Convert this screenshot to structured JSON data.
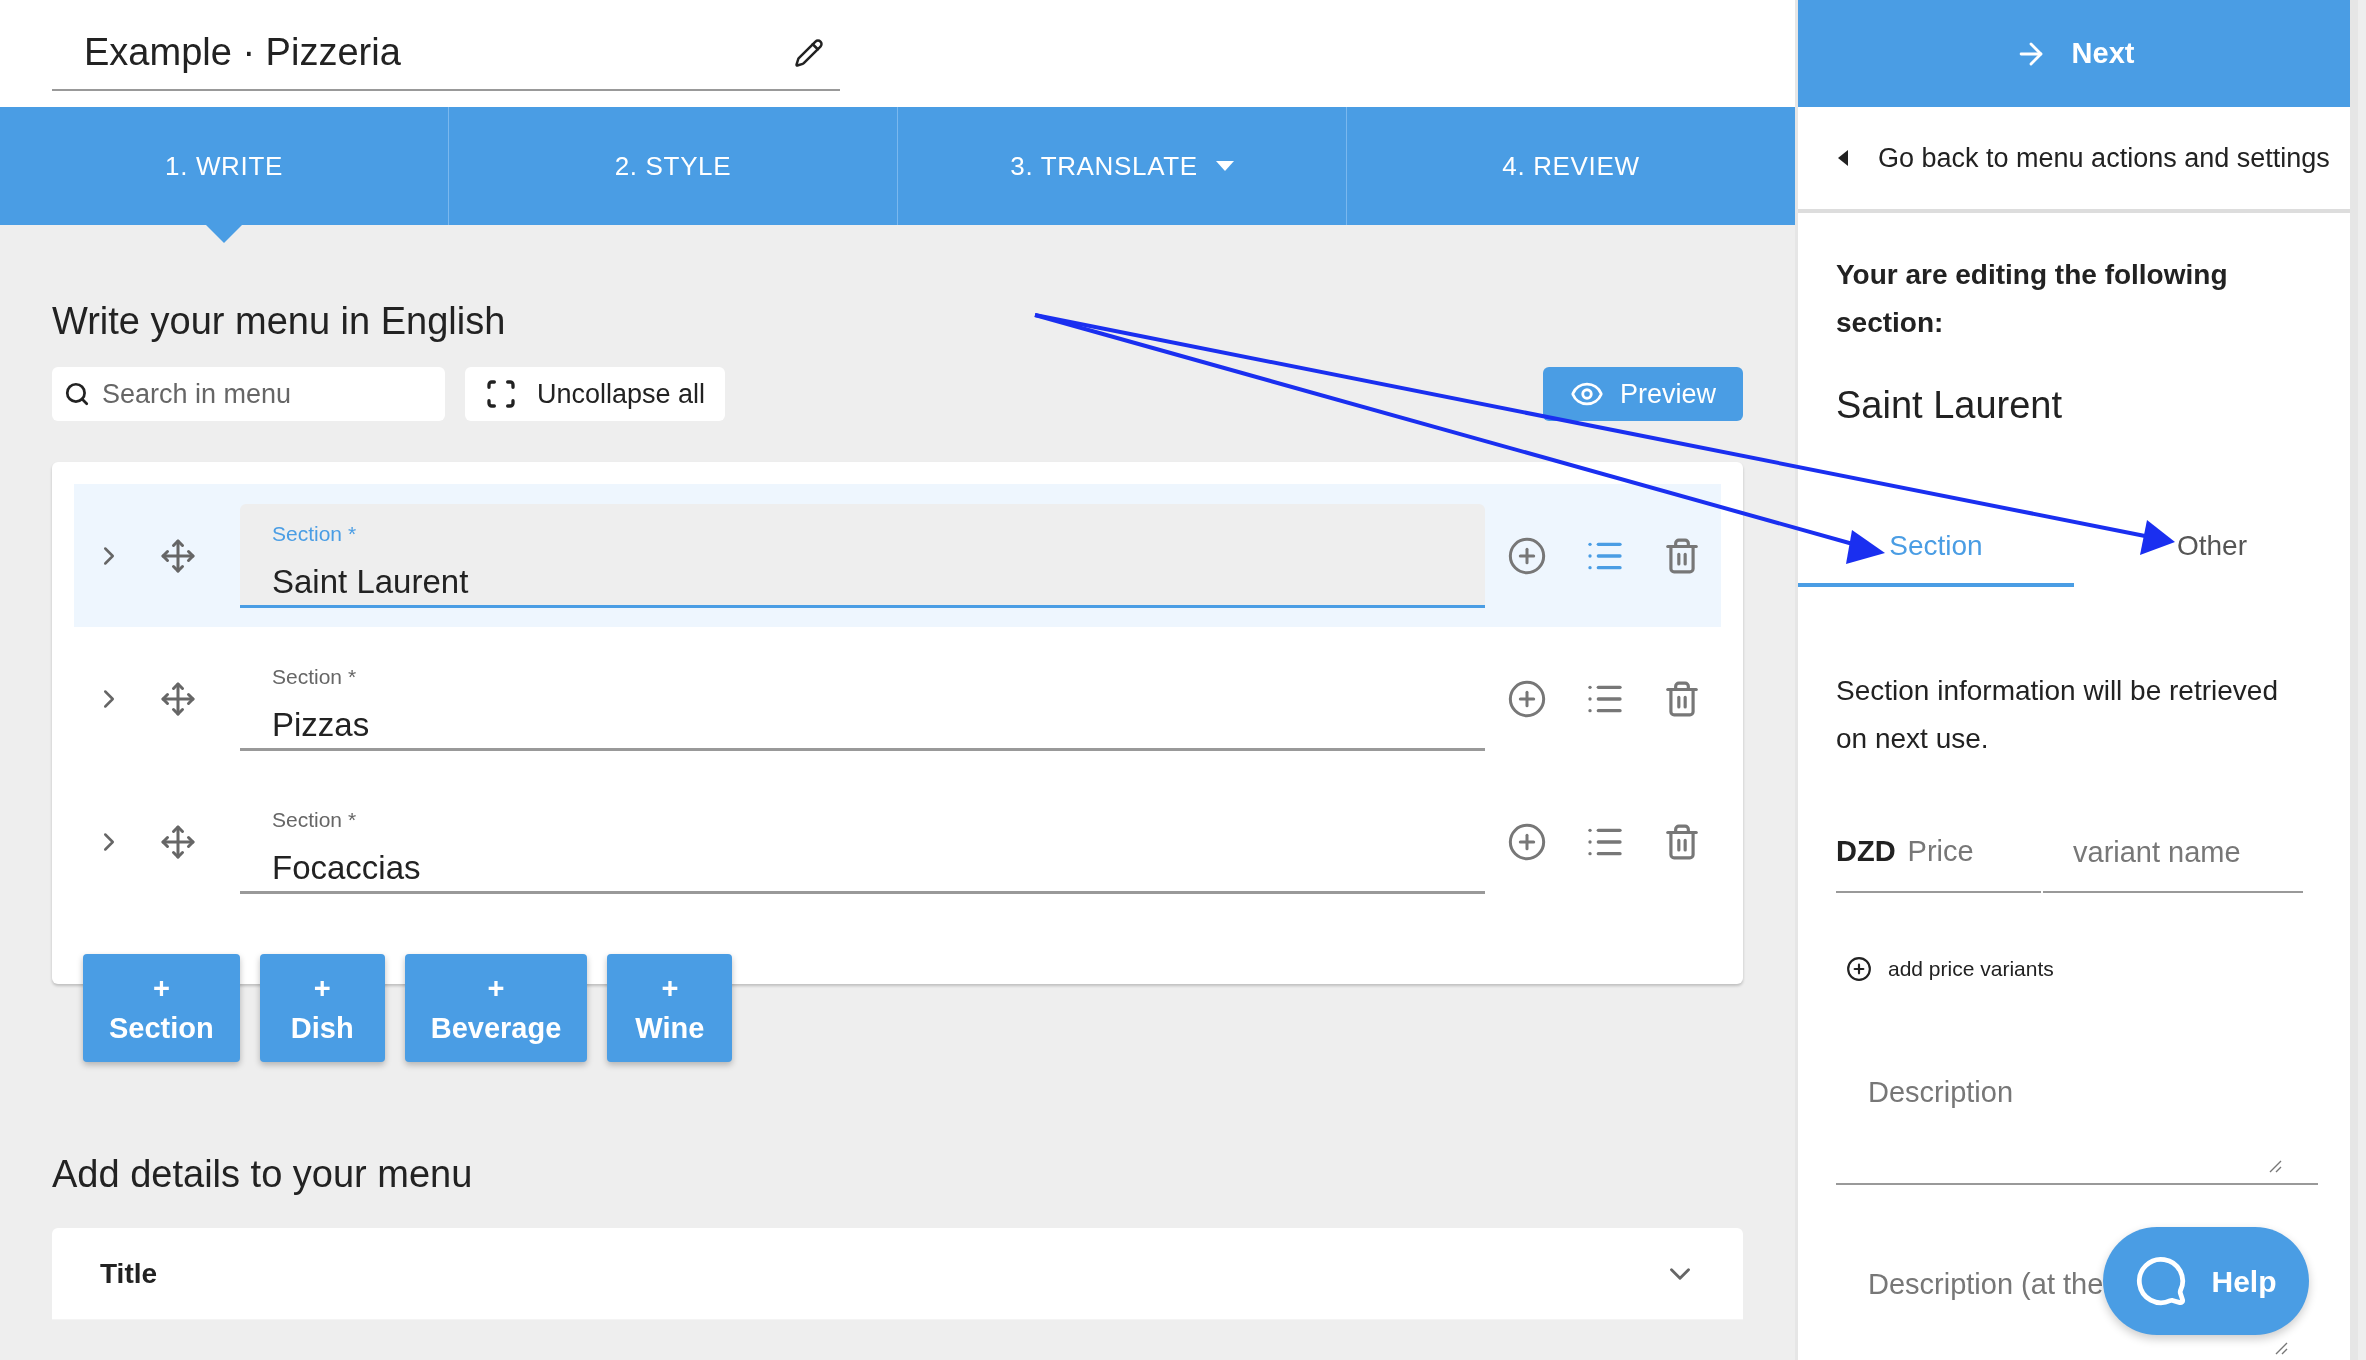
{
  "header": {
    "title": "Example · Pizzeria"
  },
  "steps": [
    {
      "label": "1. WRITE",
      "selected": true,
      "dropdown": false
    },
    {
      "label": "2. STYLE",
      "selected": false,
      "dropdown": false
    },
    {
      "label": "3. TRANSLATE",
      "selected": false,
      "dropdown": true
    },
    {
      "label": "4. REVIEW",
      "selected": false,
      "dropdown": false
    }
  ],
  "editor": {
    "heading": "Write your menu in English",
    "search": {
      "placeholder": "Search in menu"
    },
    "uncollapse_button": "Uncollapse all",
    "preview_button": "Preview",
    "sections": [
      {
        "label": "Section *",
        "value": "Saint Laurent",
        "selected": true
      },
      {
        "label": "Section *",
        "value": "Pizzas",
        "selected": false
      },
      {
        "label": "Section *",
        "value": "Focaccias",
        "selected": false
      }
    ],
    "add_buttons": [
      {
        "symbol": "+",
        "label": "Section"
      },
      {
        "symbol": "+",
        "label": "Dish"
      },
      {
        "symbol": "+",
        "label": "Beverage"
      },
      {
        "symbol": "+",
        "label": "Wine"
      }
    ]
  },
  "details": {
    "heading": "Add details to your menu",
    "panels": [
      {
        "title": "Title",
        "expanded": false
      }
    ]
  },
  "sidebar": {
    "next_button": "Next",
    "back_link": "Go back to menu actions and settings",
    "intro": "Your are editing the following section:",
    "section_name": "Saint Laurent",
    "tabs": [
      {
        "label": "Section",
        "selected": true
      },
      {
        "label": "Other",
        "selected": false
      }
    ],
    "info": "Section information will be retrieved on next use.",
    "currency": "DZD",
    "price": {
      "placeholder": "Price"
    },
    "variant": {
      "placeholder": "variant name"
    },
    "add_variants": "add price variants",
    "description": {
      "placeholder": "Description"
    },
    "description_footer": {
      "placeholder": "Description (at the"
    }
  },
  "help_button": "Help"
}
